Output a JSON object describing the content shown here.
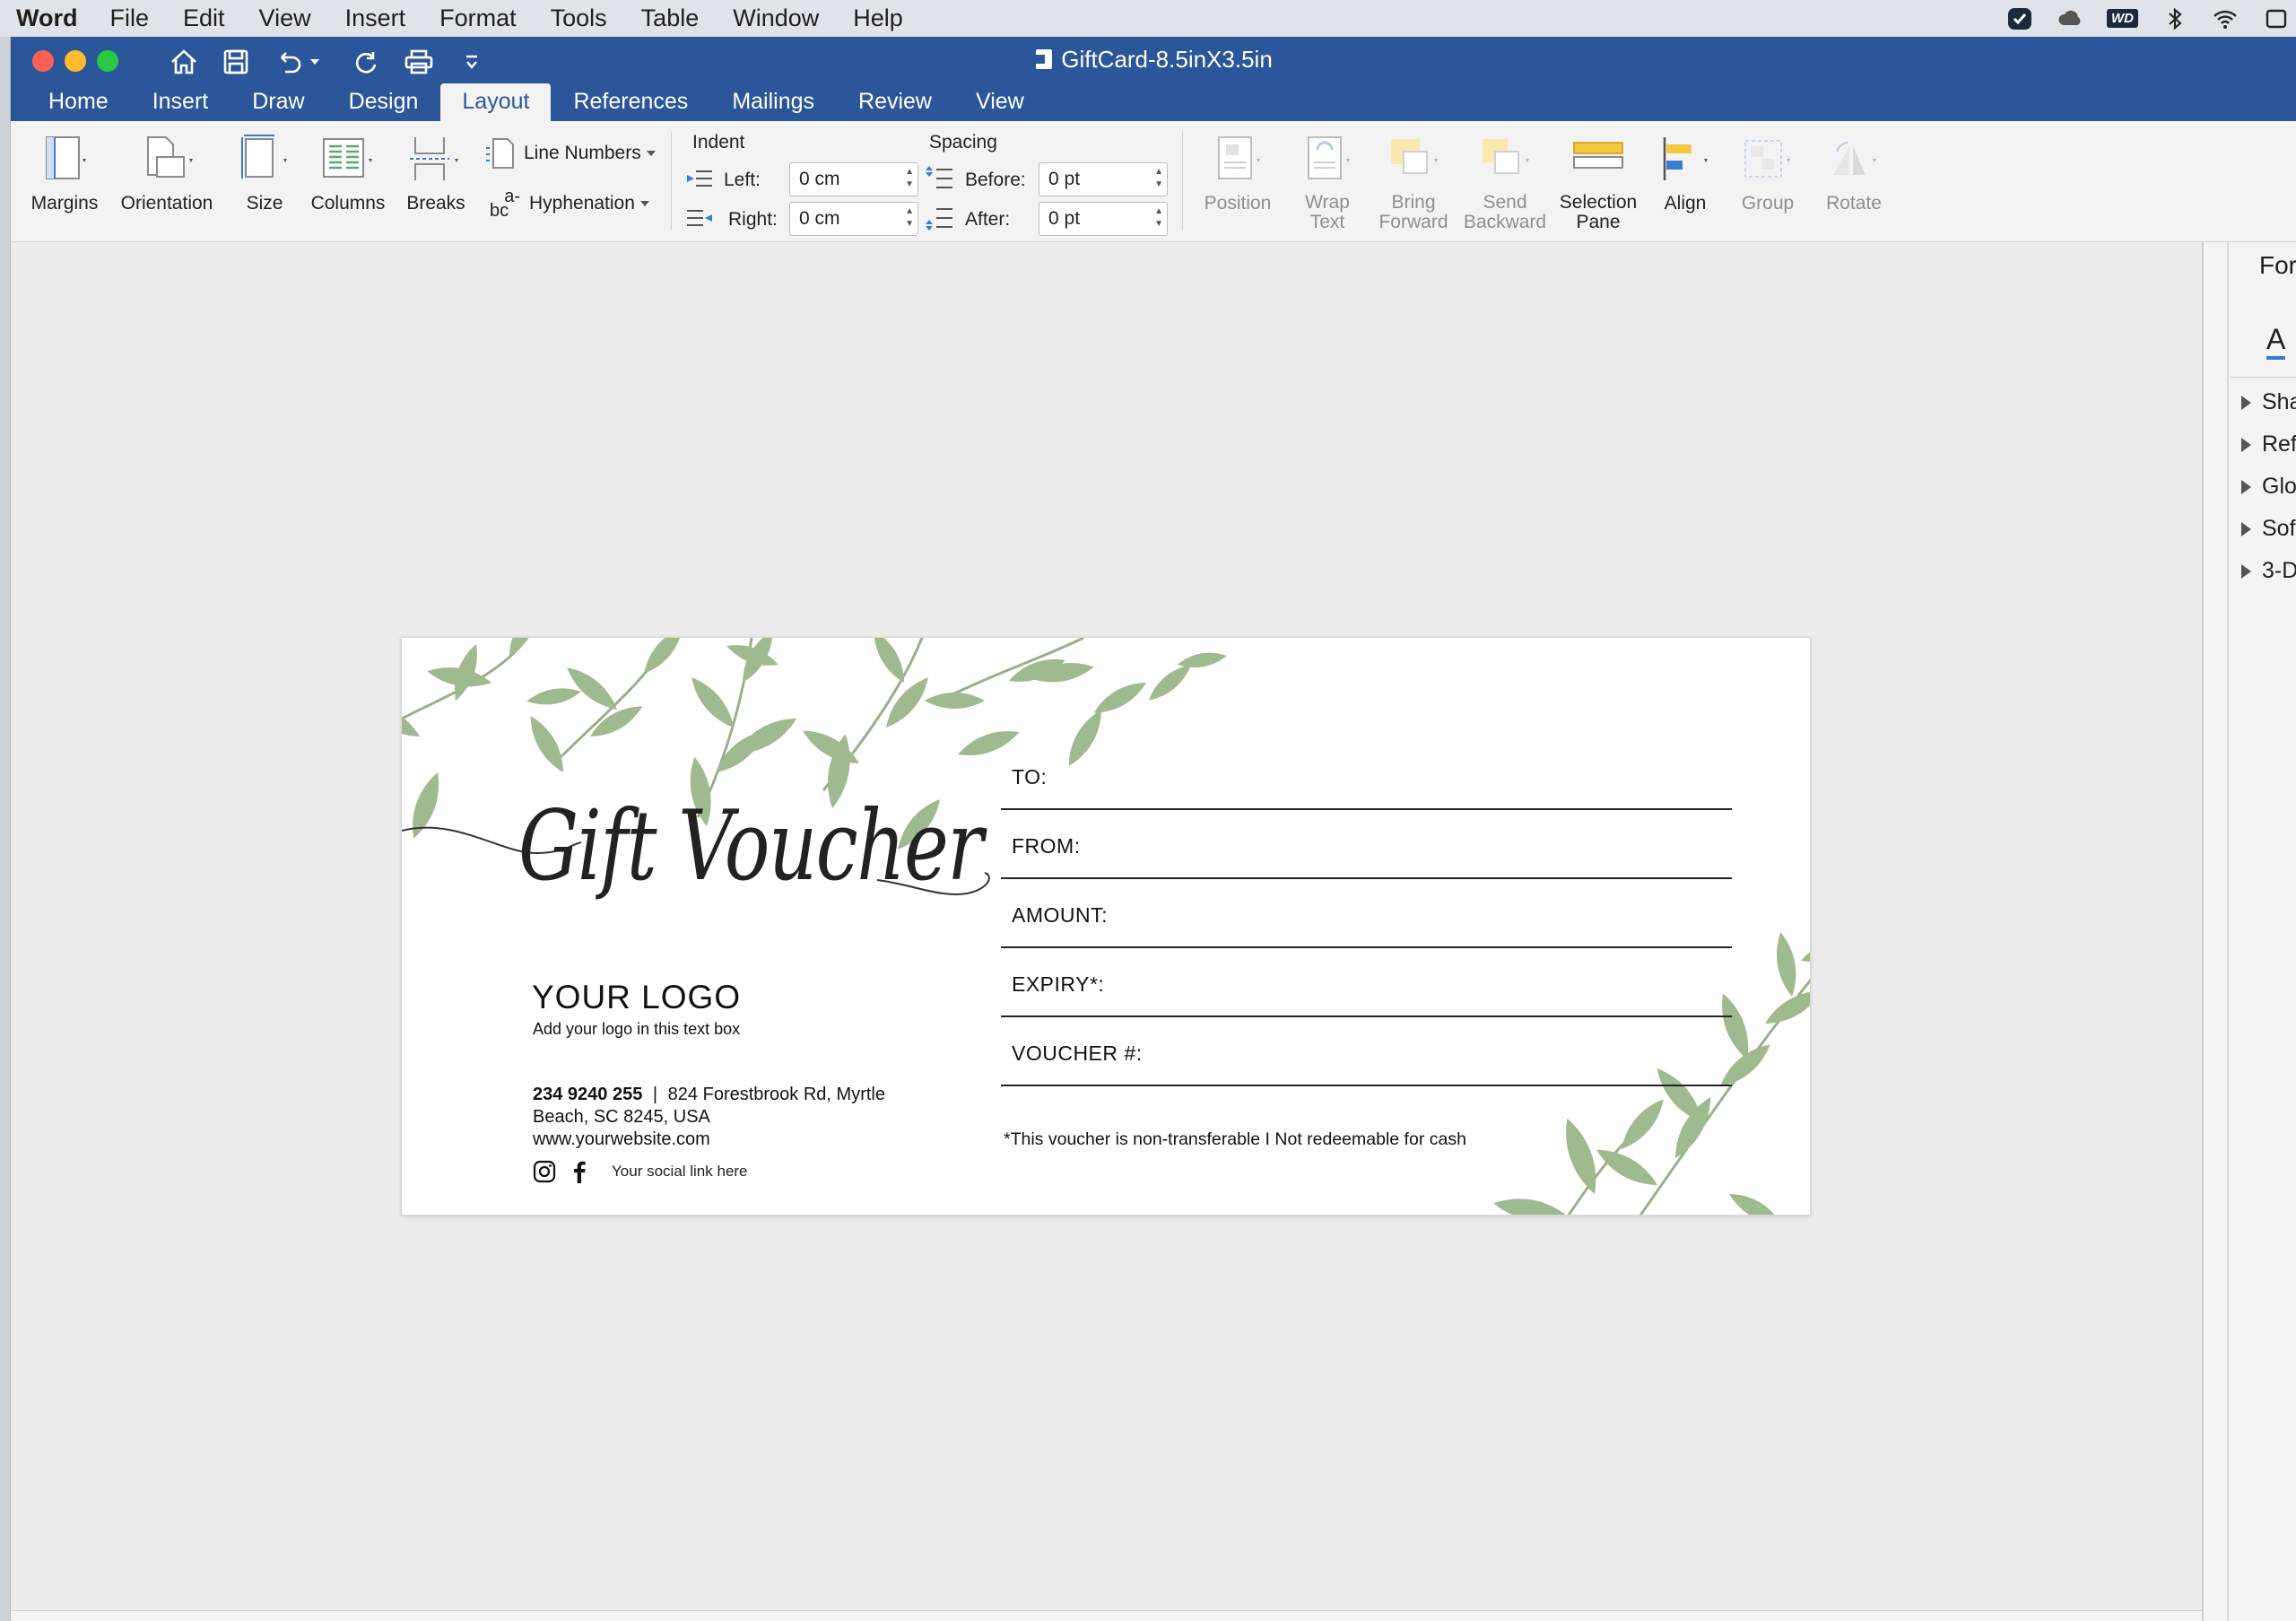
{
  "menubar": {
    "app_name": "Word",
    "items": [
      "File",
      "Edit",
      "View",
      "Insert",
      "Format",
      "Tools",
      "Table",
      "Window",
      "Help"
    ],
    "status_icons": [
      "checkmark-shield-icon",
      "creative-cloud-icon",
      "wd-drive-icon",
      "bluetooth-icon",
      "wifi-icon",
      "battery-icon"
    ],
    "wd_label": "WD"
  },
  "window": {
    "title": "GiftCard-8.5inX3.5in",
    "tabs": [
      "Home",
      "Insert",
      "Draw",
      "Design",
      "Layout",
      "References",
      "Mailings",
      "Review",
      "View"
    ],
    "active_tab": "Layout",
    "colors": {
      "title_bar": "#2b579a",
      "ribbon": "#f3f3f3",
      "canvas": "#ececec"
    }
  },
  "ribbon": {
    "margins": "Margins",
    "orientation": "Orientation",
    "size": "Size",
    "columns": "Columns",
    "breaks": "Breaks",
    "line_numbers": "Line Numbers",
    "hyphenation": "Hyphenation",
    "hyphen_glyph_top": "a-",
    "hyphen_glyph_bottom": "bc",
    "indent": {
      "heading": "Indent",
      "left_label": "Left:",
      "left_value": "0 cm",
      "right_label": "Right:",
      "right_value": "0 cm"
    },
    "spacing": {
      "heading": "Spacing",
      "before_label": "Before:",
      "before_value": "0 pt",
      "after_label": "After:",
      "after_value": "0 pt"
    },
    "position": "Position",
    "wrap_text": [
      "Wrap",
      "Text"
    ],
    "bring_forward": [
      "Bring",
      "Forward"
    ],
    "send_backward": [
      "Send",
      "Backward"
    ],
    "selection_pane": [
      "Selection",
      "Pane"
    ],
    "align": "Align",
    "group": "Group",
    "rotate": "Rotate"
  },
  "format_pane": {
    "title": "For",
    "tab_glyph": "A",
    "items": [
      "Sha",
      "Ref",
      "Glo",
      "Sof",
      "3-D"
    ]
  },
  "card": {
    "title": "Gift Voucher",
    "logo": "YOUR LOGO",
    "logo_sub": "Add your logo in this text box",
    "phone": "234 9240 255",
    "separator": "|",
    "address": "824 Forestbrook Rd, Myrtle Beach, SC 8245, USA",
    "website": "www.yourwebsite.com",
    "social_link": "Your social link here",
    "fields": [
      "TO:",
      "FROM:",
      "AMOUNT:",
      "EXPIRY*:",
      "VOUCHER #:"
    ],
    "disclaimer": "*This voucher is non-transferable I Not redeemable for cash",
    "leaf_color": "#8aa877"
  }
}
